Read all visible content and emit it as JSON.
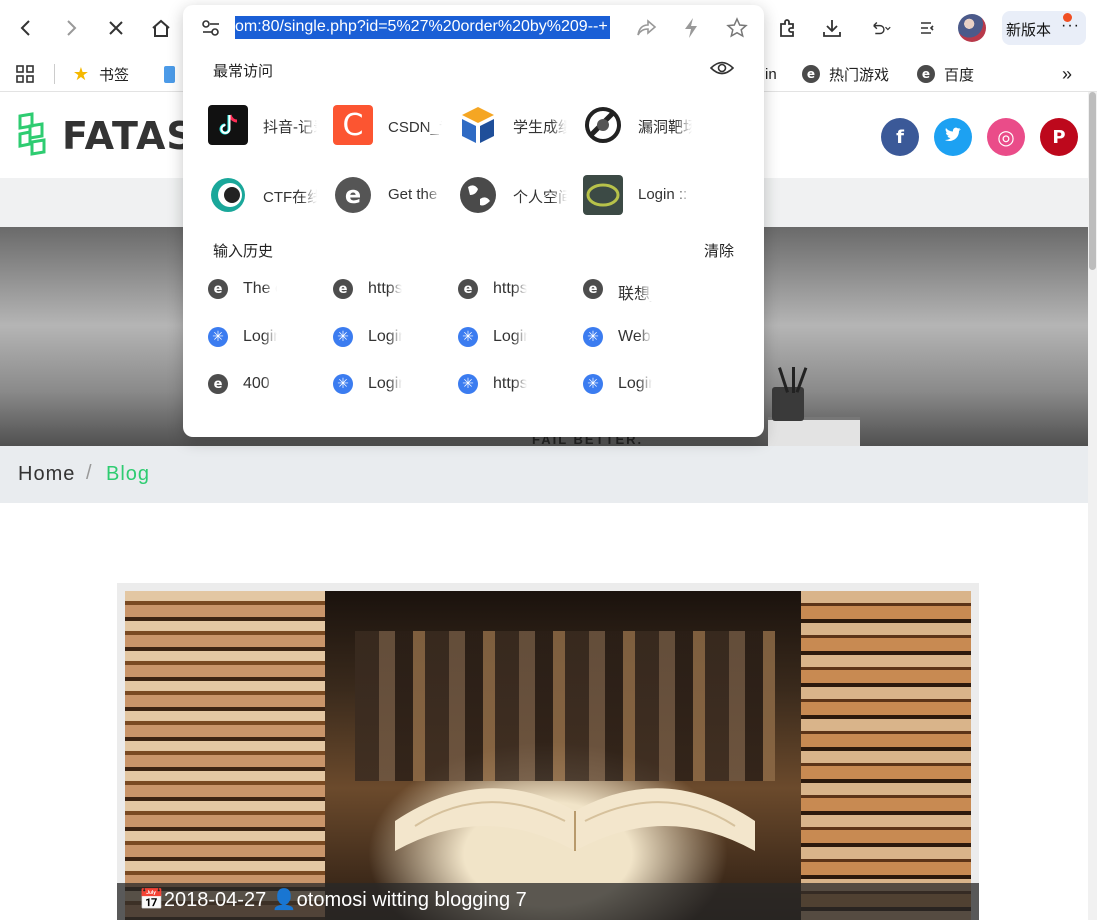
{
  "browser": {
    "url": "om:80/single.php?id=5%27%20order%20by%209--+",
    "new_version_label": "新版本",
    "more_label": "···"
  },
  "bookmarks": {
    "items": [
      {
        "label": "书签",
        "icon": "star-icon"
      },
      {
        "label": "",
        "icon": "mobile-icon"
      },
      {
        "label": "in",
        "icon": ""
      },
      {
        "label": "热门游戏",
        "icon": "e-browser-icon"
      },
      {
        "label": "百度",
        "icon": "e-browser-icon"
      }
    ],
    "more_label": "»"
  },
  "dropdown": {
    "frequent_title": "最常访问",
    "history_title": "输入历史",
    "clear_label": "清除",
    "tiles": [
      {
        "label": "抖音-记录美好生活",
        "icon": "douyin-icon"
      },
      {
        "label": "CSDN_专业开发者社区",
        "icon": "csdn-icon"
      },
      {
        "label": "学生成绩管理系统",
        "icon": "rf-icon"
      },
      {
        "label": "漏洞靶场",
        "icon": "vuln-range-icon"
      },
      {
        "label": "CTF在线平台",
        "icon": "ctf-icon"
      },
      {
        "label": "Get the",
        "icon": "e-browser-icon"
      },
      {
        "label": "个人空间",
        "icon": "globe-dark-icon"
      },
      {
        "label": "Login ::",
        "icon": "login-thumb-icon"
      }
    ],
    "history": [
      {
        "label": "The c",
        "icon": "e-browser-icon"
      },
      {
        "label": "https",
        "icon": "e-browser-icon"
      },
      {
        "label": "https",
        "icon": "e-browser-icon"
      },
      {
        "label": "联想_",
        "icon": "e-browser-icon"
      },
      {
        "label": "Login",
        "icon": "globe-icon"
      },
      {
        "label": "Login",
        "icon": "globe-icon"
      },
      {
        "label": "Login",
        "icon": "globe-icon"
      },
      {
        "label": "Web",
        "icon": "globe-icon"
      },
      {
        "label": "400",
        "icon": "e-browser-icon"
      },
      {
        "label": "Login",
        "icon": "globe-icon"
      },
      {
        "label": "https",
        "icon": "globe-icon"
      },
      {
        "label": "Login",
        "icon": "globe-icon"
      }
    ]
  },
  "site": {
    "logo_text": "FATAS",
    "social": [
      {
        "name": "facebook",
        "glyph": "f",
        "color": "#3b5998"
      },
      {
        "name": "twitter",
        "glyph": "t",
        "color": "#1da1f2"
      },
      {
        "name": "dribbble",
        "glyph": "◎",
        "color": "#ea4c89"
      },
      {
        "name": "pinterest",
        "glyph": "P",
        "color": "#bd081c"
      }
    ],
    "hero_caption": "FAIL BETTER.",
    "breadcrumb": {
      "home": "Home",
      "separator": "/",
      "current": "Blog"
    },
    "post_meta": "📅2018-04-27  👤otomosi    witting blogging  7"
  },
  "colors": {
    "accent": "#2ecc71",
    "selection": "#1a5fd6",
    "notify_dot": "#f04f23"
  }
}
